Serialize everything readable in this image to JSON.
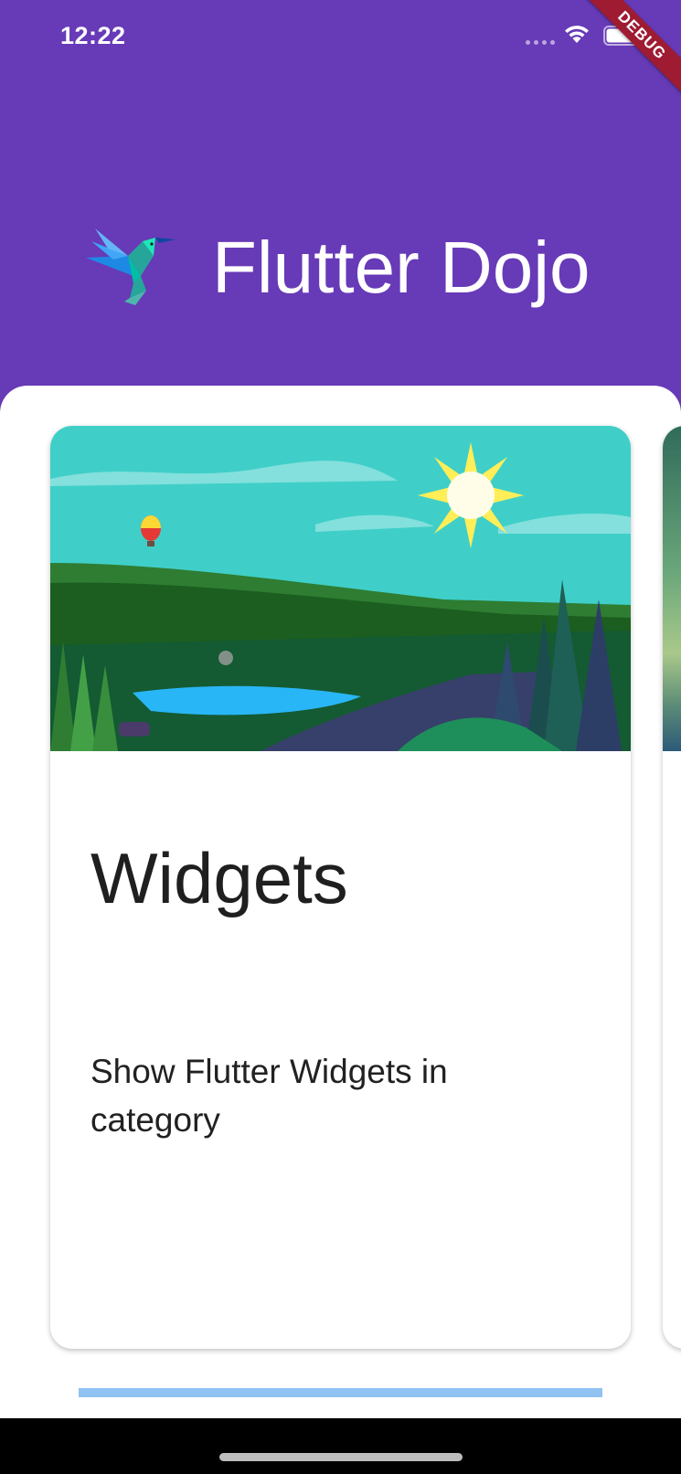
{
  "status_bar": {
    "time": "12:22"
  },
  "debug_banner": {
    "label": "DEBUG"
  },
  "header": {
    "title": "Flutter Dojo",
    "logo_icon": "hummingbird-icon",
    "background_color": "#673AB7"
  },
  "card": {
    "title": "Widgets",
    "description": "Show Flutter Widgets in category"
  },
  "page_indicator": {
    "color": "#90C2F2"
  }
}
